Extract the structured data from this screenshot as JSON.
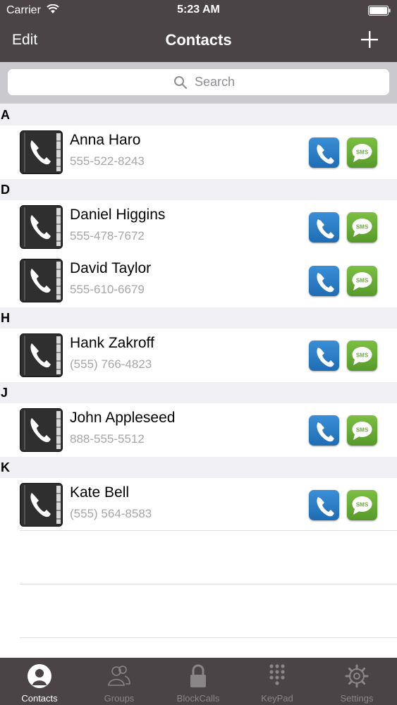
{
  "status": {
    "carrier": "Carrier",
    "time": "5:23 AM"
  },
  "nav": {
    "edit_label": "Edit",
    "title": "Contacts"
  },
  "search": {
    "placeholder": "Search"
  },
  "sections": [
    {
      "letter": "A",
      "contacts": [
        {
          "name": "Anna Haro",
          "phone": "555-522-8243"
        }
      ]
    },
    {
      "letter": "D",
      "contacts": [
        {
          "name": "Daniel Higgins",
          "phone": "555-478-7672"
        },
        {
          "name": "David Taylor",
          "phone": "555-610-6679"
        }
      ]
    },
    {
      "letter": "H",
      "contacts": [
        {
          "name": "Hank Zakroff",
          "phone": "(555) 766-4823"
        }
      ]
    },
    {
      "letter": "J",
      "contacts": [
        {
          "name": "John Appleseed",
          "phone": "888-555-5512"
        }
      ]
    },
    {
      "letter": "K",
      "contacts": [
        {
          "name": "Kate Bell",
          "phone": "(555) 564-8583"
        }
      ]
    }
  ],
  "sms_label": "SMS",
  "tabs": [
    {
      "label": "Contacts",
      "icon": "person-icon",
      "active": true
    },
    {
      "label": "Groups",
      "icon": "groups-icon",
      "active": false
    },
    {
      "label": "BlockCalls",
      "icon": "lock-icon",
      "active": false
    },
    {
      "label": "KeyPad",
      "icon": "keypad-icon",
      "active": false
    },
    {
      "label": "Settings",
      "icon": "gear-icon",
      "active": false
    }
  ],
  "colors": {
    "bar": "#4a4446",
    "call": "#2a7cc7",
    "sms": "#6aad36",
    "section": "#efeff4"
  }
}
